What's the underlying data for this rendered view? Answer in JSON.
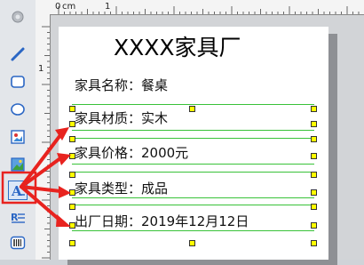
{
  "ruler": {
    "origin": "0",
    "unit": "cm",
    "h_one": "1",
    "v_one": "1"
  },
  "label": {
    "title": "XXXX家具厂",
    "fields": [
      {
        "text": "家具名称：餐桌"
      },
      {
        "text": "家具材质：实木"
      },
      {
        "text": "家具价格：2000元"
      },
      {
        "text": "家具类型：成品"
      },
      {
        "text": "出厂日期：2019年12月12日"
      }
    ]
  },
  "toolbar": {
    "tools": [
      {
        "icon": "gear-icon"
      },
      {
        "icon": "line-icon"
      },
      {
        "icon": "rounded-rectangle-icon"
      },
      {
        "icon": "ellipse-icon"
      },
      {
        "icon": "picture-icon"
      },
      {
        "icon": "image-icon"
      },
      {
        "icon": "text-icon"
      },
      {
        "icon": "rich-text-icon"
      },
      {
        "icon": "barcode-icon"
      }
    ]
  },
  "colors": {
    "selection": "#39c239",
    "handle": "#ffff00",
    "callout": "#e8231f"
  }
}
